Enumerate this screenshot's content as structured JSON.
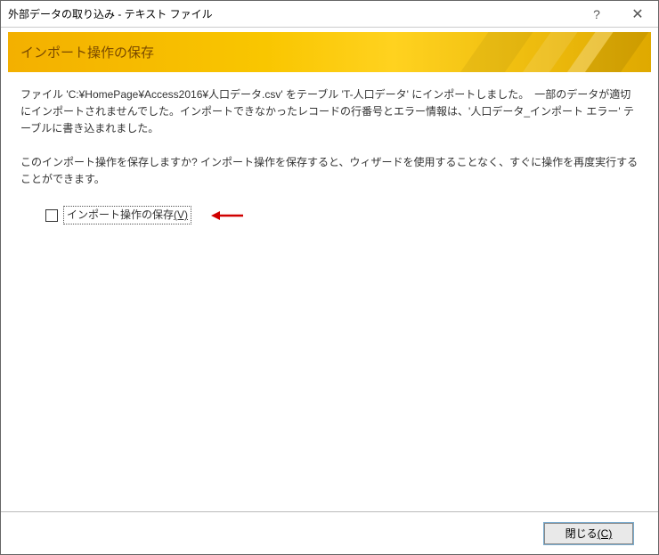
{
  "titlebar": {
    "title": "外部データの取り込み - テキスト ファイル",
    "help_symbol": "?",
    "close_symbol": "✕"
  },
  "banner": {
    "title": "インポート操作の保存"
  },
  "content": {
    "message1": "ファイル 'C:¥HomePage¥Access2016¥人口データ.csv' をテーブル 'T-人口データ' にインポートしました。　一部のデータが適切にインポートされませんでした。インポートできなかったレコードの行番号とエラー情報は、'人口データ_インポート エラー' テーブルに書き込まれました。",
    "message2": "このインポート操作を保存しますか? インポート操作を保存すると、ウィザードを使用することなく、すぐに操作を再度実行することができます。",
    "checkbox_label": "インポート操作の保存",
    "checkbox_accel": "(V)"
  },
  "footer": {
    "close_label": "閉じる",
    "close_accel": "(C)"
  }
}
